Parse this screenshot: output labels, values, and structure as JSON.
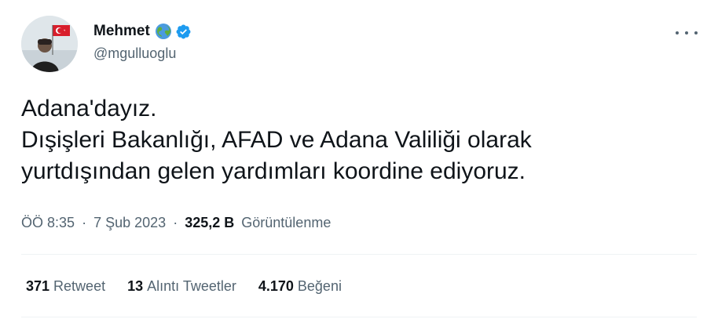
{
  "user": {
    "display_name": "Mehmet",
    "handle": "@mgulluoglu"
  },
  "tweet": {
    "lines": [
      "Adana'dayız.",
      "Dışişleri Bakanlığı, AFAD ve Adana Valiliği olarak",
      "yurtdışından gelen yardımları koordine ediyoruz."
    ]
  },
  "meta": {
    "time": "ÖÖ 8:35",
    "separator": "·",
    "date": "7 Şub 2023",
    "views_count": "325,2 B",
    "views_label": "Görüntülenme"
  },
  "stats": {
    "retweets": {
      "count": "371",
      "label": "Retweet"
    },
    "quotes": {
      "count": "13",
      "label": "Alıntı Tweetler"
    },
    "likes": {
      "count": "4.170",
      "label": "Beğeni"
    }
  },
  "icons": {
    "globe": "globe-icon",
    "verified": "verified-badge-icon",
    "more": "more-options-icon"
  },
  "colors": {
    "verified": "#1d9bf0",
    "secondary_text": "#536471",
    "primary_text": "#0f1419",
    "divider": "#eff3f4"
  }
}
